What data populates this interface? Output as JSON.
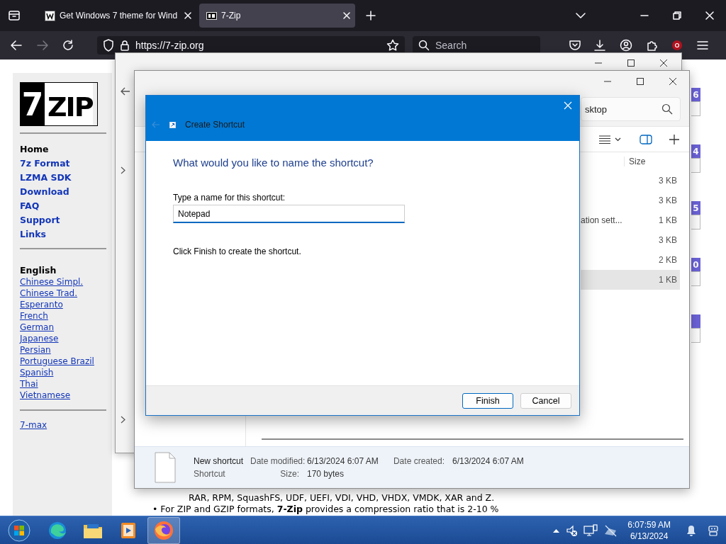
{
  "browser": {
    "tabs": [
      {
        "title": "Get Windows 7 theme for Wind",
        "selected": false
      },
      {
        "title": "7-Zip",
        "selected": true
      }
    ],
    "address": "https://7-zip.org",
    "search": {
      "placeholder": "Search"
    }
  },
  "page": {
    "logo": {
      "digit": "7",
      "word": "ZIP"
    },
    "nav": [
      {
        "label": "Home",
        "selected": true
      },
      {
        "label": "7z Format",
        "selected": false
      },
      {
        "label": "LZMA SDK",
        "selected": false
      },
      {
        "label": "Download",
        "selected": false
      },
      {
        "label": "FAQ",
        "selected": false
      },
      {
        "label": "Support",
        "selected": false
      },
      {
        "label": "Links",
        "selected": false
      }
    ],
    "languages_heading": "English",
    "languages": [
      "Chinese Simpl.",
      "Chinese Trad.",
      "Esperanto",
      "French",
      "German",
      "Japanese",
      "Persian",
      "Portuguese Brazil",
      "Spanish",
      "Thai",
      "Vietnamese"
    ],
    "extra_link": "7-max",
    "body_lines": [
      "RAR, RPM, SquashFS, UDF, UEFI, VDI, VHD, VHDX, VMDK, XAR and Z.",
      "• For ZIP and GZIP formats, **7-Zip** provides a compression ratio that is 2-10 %"
    ],
    "side_marks": [
      {
        "kind": "digit",
        "text": "6"
      },
      {
        "kind": "digit",
        "text": "4"
      },
      {
        "kind": "digit",
        "text": "5"
      },
      {
        "kind": "digit",
        "text": "0"
      },
      {
        "kind": "blank"
      }
    ]
  },
  "explorer": {
    "search": {
      "value": "sktop"
    },
    "columns": [
      {
        "label": "Size"
      }
    ],
    "rows": [
      {
        "size": "3 KB",
        "selected": false
      },
      {
        "size": "3 KB",
        "selected": false
      },
      {
        "column_1": "ation sett...",
        "size": "1 KB",
        "selected": false
      },
      {
        "size": "3 KB",
        "selected": false
      },
      {
        "size": "2 KB",
        "selected": false
      },
      {
        "size": "1 KB",
        "selected": true
      }
    ],
    "details": {
      "name": "New shortcut",
      "type": "Shortcut",
      "fields": [
        {
          "label": "Date modified:",
          "value": "6/13/2024 6:07 AM"
        },
        {
          "label": "Size:",
          "value": "170 bytes"
        },
        {
          "label": "Date created:",
          "value": "6/13/2024 6:07 AM"
        }
      ]
    }
  },
  "dialog": {
    "title": "Create Shortcut",
    "heading": "What would you like to name the shortcut?",
    "field_label": "Type a name for this shortcut:",
    "field_value": "Notepad",
    "instruction": "Click Finish to create the shortcut.",
    "buttons": [
      {
        "label": "Finish",
        "default": true
      },
      {
        "label": "Cancel",
        "default": false
      }
    ]
  },
  "taskbar": {
    "apps": [
      {
        "kind": "start",
        "active": false
      },
      {
        "kind": "edge",
        "active": false
      },
      {
        "kind": "explorer",
        "active": false
      },
      {
        "kind": "media",
        "active": false
      },
      {
        "kind": "firefox",
        "active": true
      }
    ],
    "time": "6:07:59 AM",
    "date": "6/13/2024"
  }
}
